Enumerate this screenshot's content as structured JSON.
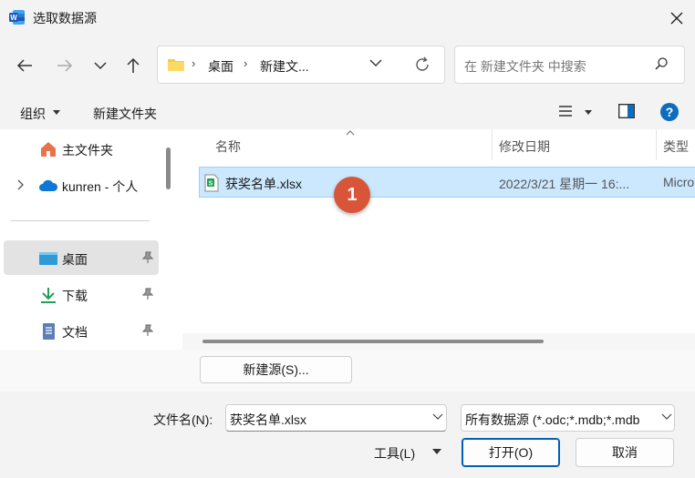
{
  "window": {
    "title": "选取数据源",
    "app_icon": "word-icon"
  },
  "nav": {
    "back_icon": "back-arrow-icon",
    "forward_icon": "forward-arrow-icon",
    "recent_icon": "chevron-down-icon",
    "up_icon": "up-arrow-icon",
    "breadcrumb": [
      "桌面",
      "新建文..."
    ],
    "search_placeholder": "在 新建文件夹 中搜索"
  },
  "command_bar": {
    "organize": "组织",
    "new_folder": "新建文件夹"
  },
  "sidebar": {
    "items": [
      {
        "label": "主文件夹",
        "icon": "home-icon"
      },
      {
        "label": "kunren - 个人",
        "icon": "onedrive-cloud-icon"
      },
      {
        "label": "桌面",
        "icon": "desktop-icon",
        "selected": true
      },
      {
        "label": "下载",
        "icon": "download-icon"
      },
      {
        "label": "文档",
        "icon": "document-icon"
      }
    ]
  },
  "file_list": {
    "columns": [
      "名称",
      "修改日期",
      "类型"
    ],
    "rows": [
      {
        "name": "获奖名单.xlsx",
        "modified": "2022/3/21 星期一 16:...",
        "type": "Micro",
        "selected": true
      }
    ]
  },
  "annotation": {
    "step": "1",
    "color": "#d9553a"
  },
  "footer": {
    "new_source": "新建源(S)...",
    "filename_label": "文件名(N):",
    "filename_value": "获奖名单.xlsx",
    "filter_value": "所有数据源 (*.odc;*.mdb;*.mdb",
    "tools": "工具(L)",
    "open": "打开(O)",
    "cancel": "取消"
  },
  "colors": {
    "accent": "#005fb8",
    "selection": "#cce8ff",
    "help": "#0f6cbd"
  }
}
